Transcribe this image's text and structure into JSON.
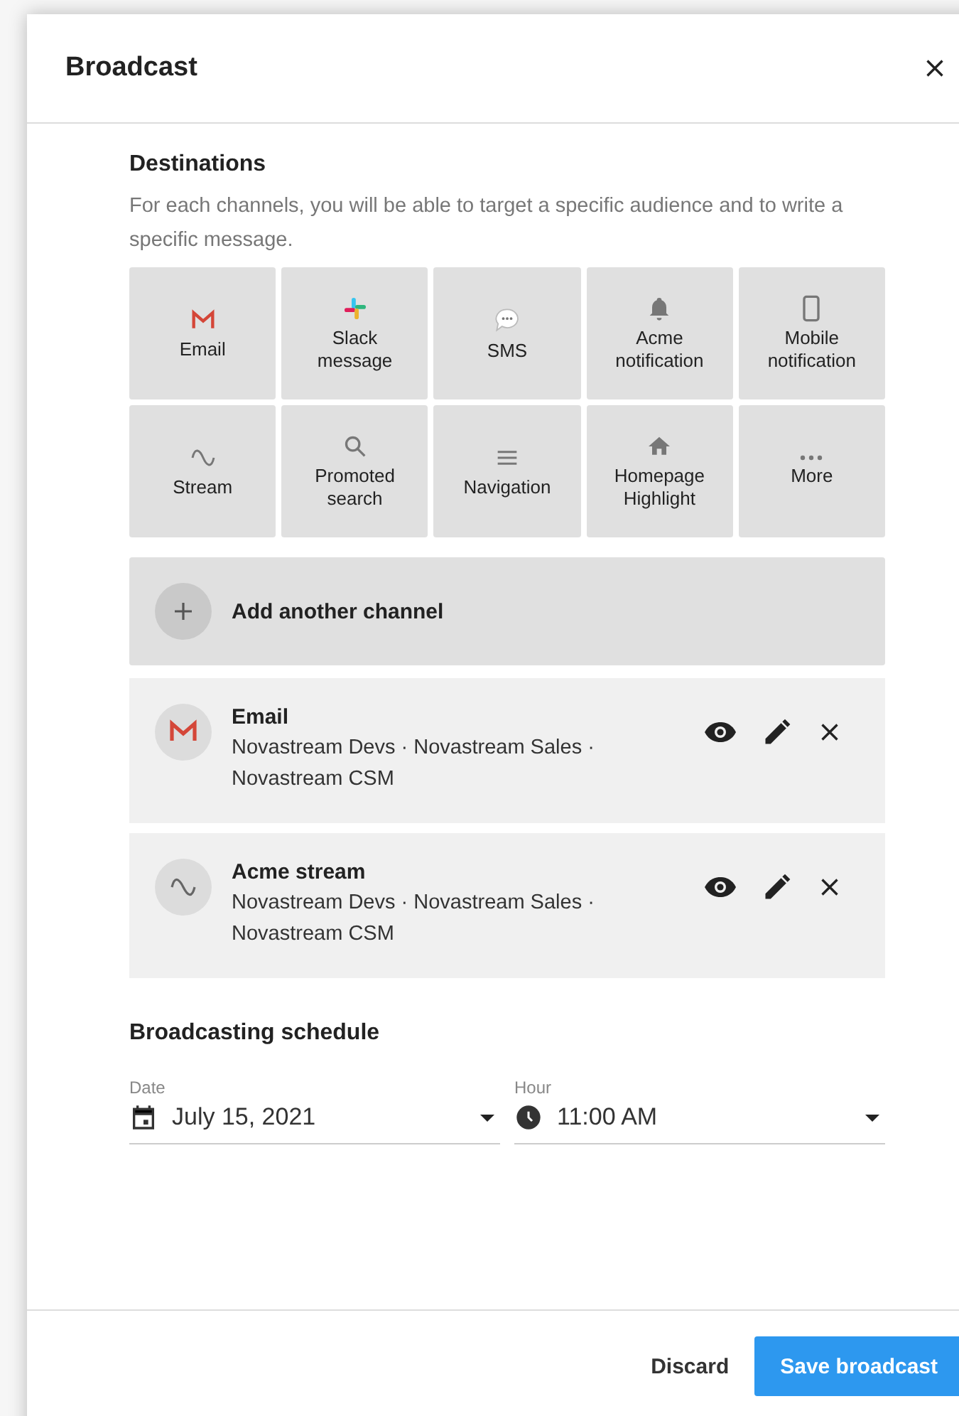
{
  "dialog": {
    "title": "Broadcast"
  },
  "destinations": {
    "title": "Destinations",
    "description": "For each channels, you will be able to target a specific audience and to write a specific message.",
    "tiles": [
      {
        "kind": "email",
        "label": "Email"
      },
      {
        "kind": "slack",
        "label": "Slack message"
      },
      {
        "kind": "sms",
        "label": "SMS"
      },
      {
        "kind": "bell",
        "label": "Acme notification"
      },
      {
        "kind": "phone",
        "label": "Mobile notification"
      },
      {
        "kind": "stream",
        "label": "Stream"
      },
      {
        "kind": "search",
        "label": "Promoted search"
      },
      {
        "kind": "menu",
        "label": "Navigation"
      },
      {
        "kind": "home",
        "label": "Homepage Highlight"
      },
      {
        "kind": "more",
        "label": "More"
      }
    ],
    "add_channel": "Add another channel",
    "channels": [
      {
        "kind": "email",
        "name": "Email",
        "audience": "Novastream Devs · Novastream Sales · Novastream CSM"
      },
      {
        "kind": "stream",
        "name": "Acme stream",
        "audience": "Novastream Devs · Novastream Sales · Novastream CSM"
      }
    ]
  },
  "schedule": {
    "title": "Broadcasting schedule",
    "date": {
      "label": "Date",
      "value": "July 15, 2021"
    },
    "hour": {
      "label": "Hour",
      "value": "11:00 AM"
    }
  },
  "footer": {
    "discard": "Discard",
    "save": "Save broadcast"
  }
}
